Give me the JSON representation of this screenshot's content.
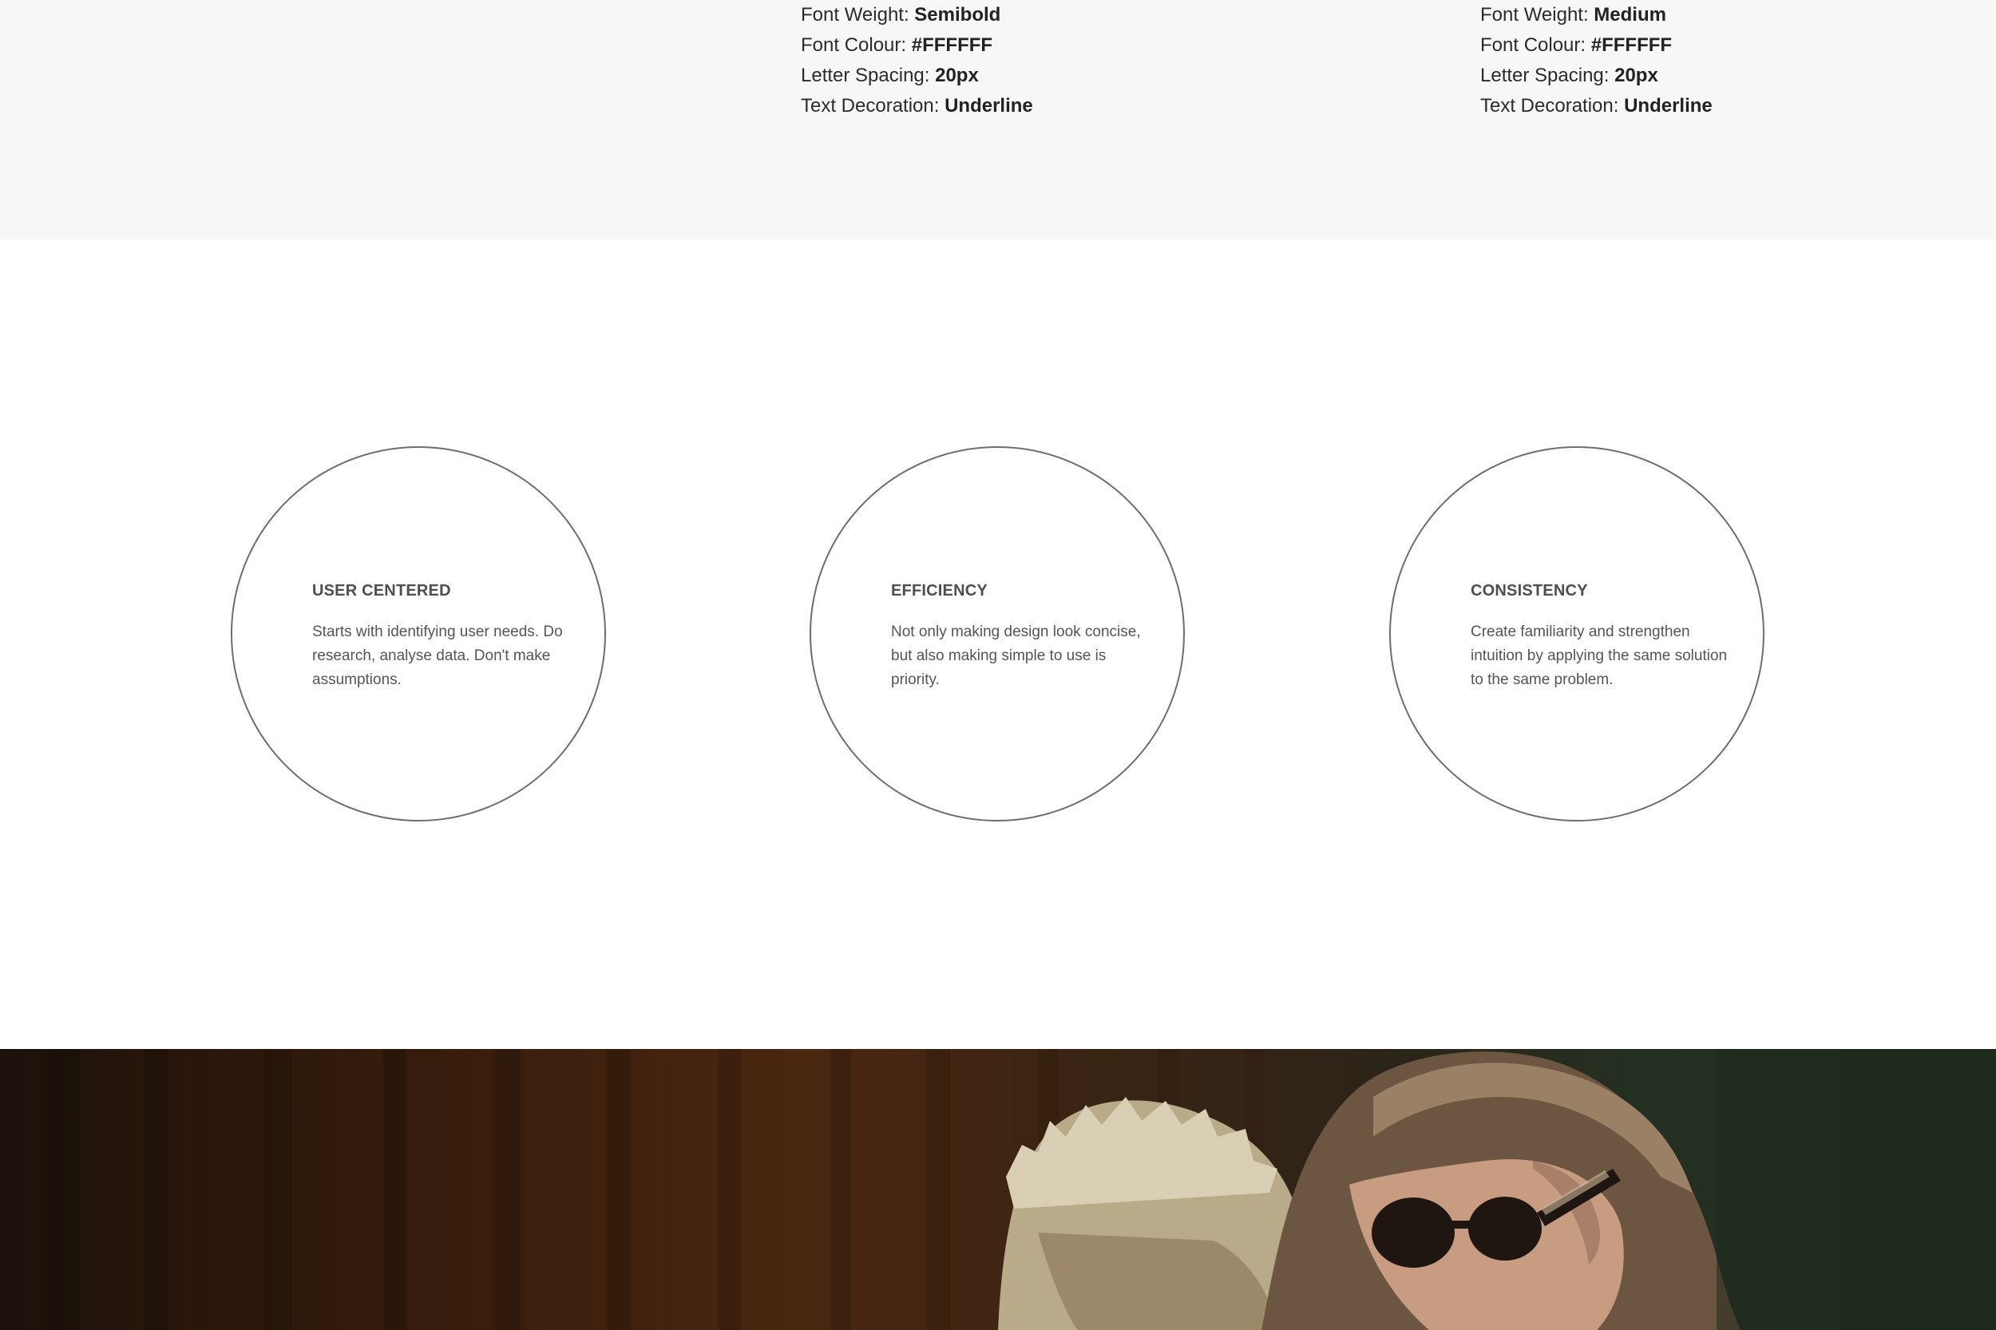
{
  "specs": {
    "left": [
      {
        "label": "Font Weight: ",
        "value": "Semibold"
      },
      {
        "label": "Font Colour: ",
        "value": "#FFFFFF"
      },
      {
        "label": "Letter Spacing: ",
        "value": "20px"
      },
      {
        "label": "Text Decoration: ",
        "value": "Underline"
      }
    ],
    "right": [
      {
        "label": "Font Weight: ",
        "value": "Medium"
      },
      {
        "label": "Font Colour: ",
        "value": "#FFFFFF"
      },
      {
        "label": "Letter Spacing: ",
        "value": "20px"
      },
      {
        "label": "Text Decoration: ",
        "value": "Underline"
      }
    ]
  },
  "principles": [
    {
      "title": "USER CENTERED",
      "body": "Starts with identifying user needs. Do research, analyse data. Don't make assumptions."
    },
    {
      "title": "EFFICIENCY",
      "body": "Not only making design look concise, but also making simple to use is priority."
    },
    {
      "title": "CONSISTENCY",
      "body": "Create familiarity and strengthen intuition by applying the same solution to the same problem."
    }
  ],
  "colors": {
    "spec_band_bg": "#f7f7f7",
    "circle_stroke": "#6e6e6e",
    "photo_tone": "#3a1e0d"
  }
}
